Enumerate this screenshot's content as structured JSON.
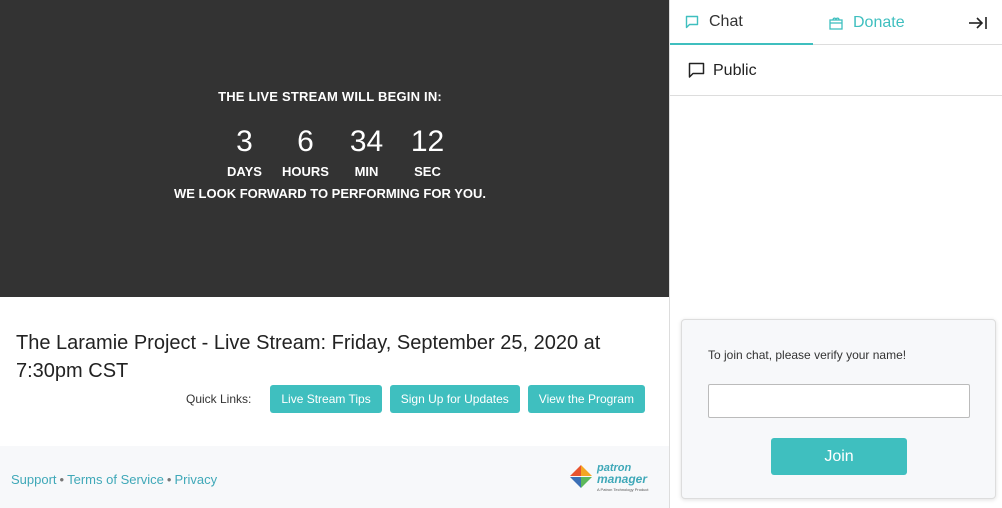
{
  "countdown": {
    "heading": "THE LIVE STREAM WILL BEGIN IN:",
    "units": [
      {
        "value": "3",
        "label": "DAYS"
      },
      {
        "value": "6",
        "label": "HOURS"
      },
      {
        "value": "34",
        "label": "MIN"
      },
      {
        "value": "12",
        "label": "SEC"
      }
    ],
    "footer": "WE LOOK FORWARD TO PERFORMING FOR YOU."
  },
  "event": {
    "title": "The Laramie Project - Live Stream: Friday, September 25, 2020 at 7:30pm CST"
  },
  "quick_links": {
    "label": "Quick Links:",
    "buttons": [
      "Live Stream Tips",
      "Sign Up for Updates",
      "View the Program"
    ]
  },
  "footer": {
    "links": [
      "Support",
      "Terms of Service",
      "Privacy"
    ],
    "separator": "•",
    "logo_line1": "patron",
    "logo_line2": "manager",
    "logo_sub": "A Patron Technology Product"
  },
  "sidebar": {
    "tabs": {
      "chat": "Chat",
      "donate": "Donate"
    },
    "channel": "Public",
    "join": {
      "prompt": "To join chat, please verify your name!",
      "input_placeholder": "",
      "button": "Join"
    }
  },
  "colors": {
    "accent": "#3fbfbf",
    "player_bg": "#333333",
    "link": "#3fa8b8"
  },
  "icons": [
    "chat-icon",
    "donate-icon",
    "collapse-panel-icon",
    "public-chat-icon",
    "patron-manager-logo"
  ]
}
